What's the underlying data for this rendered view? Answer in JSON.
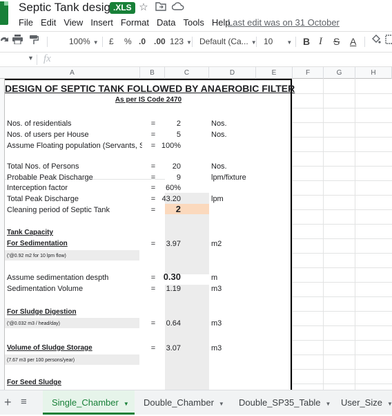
{
  "app": {
    "doc_title": "Septic Tank design",
    "file_badge": ".XLS",
    "last_edit": "Last edit was on 31 October",
    "menu": [
      "File",
      "Edit",
      "View",
      "Insert",
      "Format",
      "Data",
      "Tools",
      "Help"
    ],
    "icons": {
      "star": "star-icon",
      "move": "move-to-folder-icon",
      "cloud": "cloud-status-icon"
    }
  },
  "toolbar": {
    "zoom": "100%",
    "currency": "£",
    "percent": "%",
    "dec_decrease": ".0",
    "dec_increase": ".00",
    "format_more": "123",
    "font": "Default (Ca...",
    "font_size": "10",
    "bold": "B",
    "italic": "I",
    "strike": "S",
    "text_color": "A"
  },
  "formula_bar": {
    "fx": "fx",
    "value": ""
  },
  "columns": [
    "A",
    "B",
    "C",
    "D",
    "E",
    "F",
    "G",
    "H"
  ],
  "sheet": {
    "title": "DESIGN OF SEPTIC TANK FOLLOWED BY ANAEROBIC FILTER",
    "subtitle": "As per IS Code 2470",
    "rows": {
      "residentials": {
        "label": "Nos. of residentials",
        "eq": "=",
        "value": "2",
        "unit": "Nos."
      },
      "users": {
        "label": "Nos. of users per House",
        "eq": "=",
        "value": "5",
        "unit": "Nos."
      },
      "floating": {
        "label": "Assume Floating population (Servants, S",
        "eq": "=",
        "value": "100%",
        "unit": ""
      },
      "total_persons": {
        "label": "Total Nos. of Persons",
        "eq": "=",
        "value": "20",
        "unit": "Nos."
      },
      "peak": {
        "label": "Probable Peak Discharge",
        "eq": "=",
        "value": "9",
        "unit": "lpm/fixture"
      },
      "interception": {
        "label": "Interception factor",
        "eq": "=",
        "value": "60%",
        "unit": ""
      },
      "total_peak": {
        "label": "Total Peak Discharge",
        "eq": "=",
        "value": "43.20",
        "unit": "lpm"
      },
      "cleaning": {
        "label": "Cleaning period of Septic Tank",
        "eq": "=",
        "value": "2",
        "unit": ""
      },
      "sedimentation": {
        "section": "Tank Capacity",
        "label": "For Sedimentation",
        "note": "('@0.92 m2 for 10 lpm flow)",
        "eq": "=",
        "value": "3.97",
        "unit": "m2"
      },
      "sed_depth": {
        "label": "Assume sedimentation despth",
        "eq": "=",
        "value": "0.30",
        "unit": "m"
      },
      "sed_volume": {
        "label": "Sedimentation Volume",
        "eq": "=",
        "value": "1.19",
        "unit": "m3"
      },
      "sludge_digestion": {
        "label": "For Sludge Digestion",
        "note": "('@0.032 m3 / head/day)",
        "eq": "=",
        "value": "0.64",
        "unit": "m3"
      },
      "sludge_storage": {
        "label": "Volume of Sludge Storage",
        "note": "(7.67 m3  per 100 persons/year)",
        "eq": "=",
        "value": "3.07",
        "unit": "m3"
      },
      "seed_sludge": {
        "label": "For Seed Sludge"
      }
    }
  },
  "tabs": {
    "add": "+",
    "all": "≡",
    "items": [
      "Single_Chamber",
      "Double_Chamber",
      "Double_SP35_Table",
      "User_Size"
    ]
  },
  "colors": {
    "accent": "#188038",
    "highlight": "#fbd9bd",
    "shade": "#ececec"
  }
}
